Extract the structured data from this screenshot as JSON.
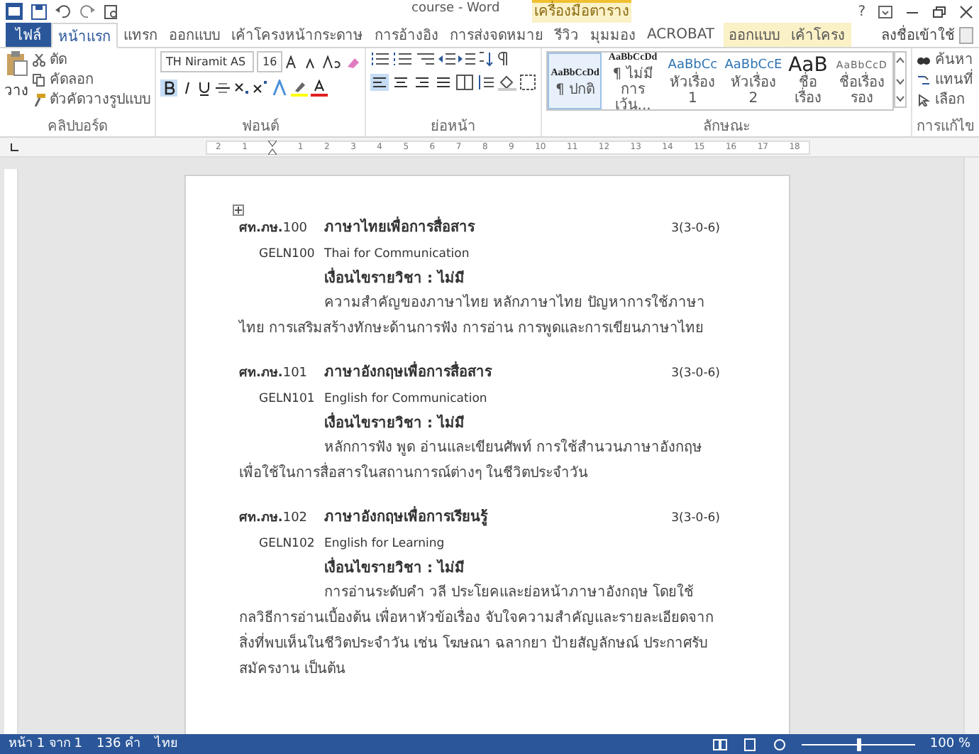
{
  "window": {
    "title": "course - Word",
    "help": "?",
    "sign_in": "ลงชื่อเข้าใช้"
  },
  "contextual_group": {
    "label": "เครื่องมือตาราง"
  },
  "tabs": [
    {
      "label": "ไฟล์",
      "kind": "file",
      "selected": false
    },
    {
      "label": "หน้าแรก",
      "kind": "normal",
      "selected": true
    },
    {
      "label": "แทรก",
      "kind": "normal",
      "selected": false
    },
    {
      "label": "ออกแบบ",
      "kind": "normal",
      "selected": false
    },
    {
      "label": "เค้าโครงหน้ากระดาษ",
      "kind": "normal",
      "selected": false
    },
    {
      "label": "การอ้างอิง",
      "kind": "normal",
      "selected": false
    },
    {
      "label": "การส่งจดหมาย",
      "kind": "normal",
      "selected": false
    },
    {
      "label": "รีวิว",
      "kind": "normal",
      "selected": false
    },
    {
      "label": "มุมมอง",
      "kind": "normal",
      "selected": false
    },
    {
      "label": "ACROBAT",
      "kind": "normal",
      "selected": false
    },
    {
      "label": "ออกแบบ",
      "kind": "contextual",
      "selected": false
    },
    {
      "label": "เค้าโครง",
      "kind": "contextual",
      "selected": false
    }
  ],
  "ribbon": {
    "clipboard": {
      "paste": "วาง",
      "cut": "ตัด",
      "copy": "คัดลอก",
      "format_painter": "ตัวคัดวางรูปแบบ",
      "group": "คลิปบอร์ด"
    },
    "font": {
      "name": "TH Niramit AS",
      "size": "16",
      "bold": true,
      "group": "ฟอนต์"
    },
    "paragraph": {
      "group": "ย่อหน้า",
      "alignments": [
        {
          "selected": true
        },
        {
          "selected": false
        },
        {
          "selected": false
        },
        {
          "selected": false
        }
      ]
    },
    "styles": {
      "group": "ลักษณะ",
      "items": [
        {
          "preview": "AaBbCcDd",
          "name": "¶ ปกติ",
          "kind": "body",
          "selected": true
        },
        {
          "preview": "AaBbCcDd",
          "name": "¶ ไม่มีการเว้น...",
          "kind": "body",
          "selected": false
        },
        {
          "preview": "AaBbCc",
          "name": "หัวเรื่อง 1",
          "kind": "heading",
          "selected": false
        },
        {
          "preview": "AaBbCcE",
          "name": "หัวเรื่อง 2",
          "kind": "heading",
          "selected": false
        },
        {
          "preview": "AaB",
          "name": "ชื่อเรื่อง",
          "kind": "title",
          "selected": false
        },
        {
          "preview": "AaBbCcD",
          "name": "ชื่อเรื่องรอง",
          "kind": "subtitle",
          "selected": false
        }
      ]
    },
    "editing": {
      "find": "ค้นหา",
      "replace": "แทนที่",
      "select": "เลือก",
      "group": "การแก้ไข"
    }
  },
  "ruler": {
    "ticks": [
      "2",
      "1",
      "1",
      "2",
      "3",
      "4",
      "5",
      "6",
      "7",
      "8",
      "9",
      "10",
      "11",
      "12",
      "13",
      "14",
      "15",
      "16",
      "17",
      "18"
    ]
  },
  "document": {
    "courses": [
      {
        "code": "**ศท.ภษ.**100",
        "title": "ภาษาไทยเพื่อการสื่อสาร",
        "credits": "3(3-0-6)",
        "english_code": "GELN100",
        "english_title": "Thai for Communication",
        "prerequisite": "เงื่อนไขรายวิชา : ไม่มี",
        "description": "ความสำคัญของภาษาไทย หลักภาษาไทย ปัญหาการใช้ภาษาไทย การเสริมสร้างทักษะด้านการฟัง การอ่าน การพูดและการเขียนภาษาไทย"
      },
      {
        "code": "**ศท.ภษ.**101",
        "title": "ภาษาอังกฤษเพื่อการสื่อสาร",
        "credits": "3(3-0-6)",
        "english_code": "GELN101",
        "english_title": "English for Communication",
        "prerequisite": "เงื่อนไขรายวิชา : ไม่มี",
        "description": "หลักการฟัง พูด อ่านและเขียนศัพท์ การใช้สำนวนภาษาอังกฤษ เพื่อใช้ในการสื่อสารในสถานการณ์ต่างๆ ในชีวิตประจำวัน"
      },
      {
        "code": "**ศท.ภษ.**102",
        "title": "ภาษาอังกฤษเพื่อการเรียนรู้",
        "credits": "3(3-0-6)",
        "english_code": "GELN102",
        "english_title": "English for Learning",
        "prerequisite": "เงื่อนไขรายวิชา : ไม่มี",
        "description": "การอ่านระดับคำ วลี ประโยคและย่อหน้าภาษาอังกฤษ โดยใช้กลวิธีการอ่านเบื้องต้น เพื่อหาหัวข้อเรื่อง จับใจความสำคัญและรายละเอียดจากสิ่งที่พบเห็นในชีวิตประจำวัน เช่น โฆษณา ฉลากยา ป้ายสัญลักษณ์ ประกาศรับสมัครงาน เป็นต้น"
      }
    ]
  },
  "status_bar": {
    "page": "หน้า 1 จาก 1",
    "words": "136 คำ",
    "language": "ไทย",
    "zoom": "100 %",
    "zoom_slider": {
      "level": 0.5
    }
  }
}
